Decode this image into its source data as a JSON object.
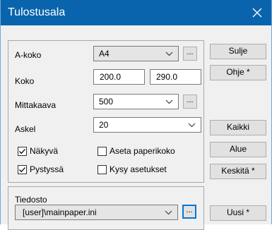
{
  "window": {
    "title": "Tulostusala",
    "title_bg": "#0a64ad"
  },
  "settings": {
    "a_size_label": "A-koko",
    "a_size_value": "A4",
    "size_label": "Koko",
    "width_value": "200.0",
    "height_value": "290.0",
    "scale_label": "Mittakaava",
    "scale_value": "500",
    "step_label": "Askel",
    "step_value": "20",
    "visible_label": "Näkyvä",
    "visible_checked": true,
    "portrait_label": "Pystyssä",
    "portrait_checked": true,
    "set_paper_size_label": "Aseta paperikoko",
    "set_paper_size_checked": false,
    "ask_settings_label": "Kysy asetukset",
    "ask_settings_checked": false,
    "dots_label": "..."
  },
  "file": {
    "label": "Tiedosto",
    "path_value": "[user]\\mainpaper.ini",
    "dots_label": "..."
  },
  "buttons": {
    "close": "Sulje",
    "help": "Ohje *",
    "all": "Kaikki",
    "area": "Alue",
    "center": "Keskitä *",
    "new": "Uusi *"
  }
}
